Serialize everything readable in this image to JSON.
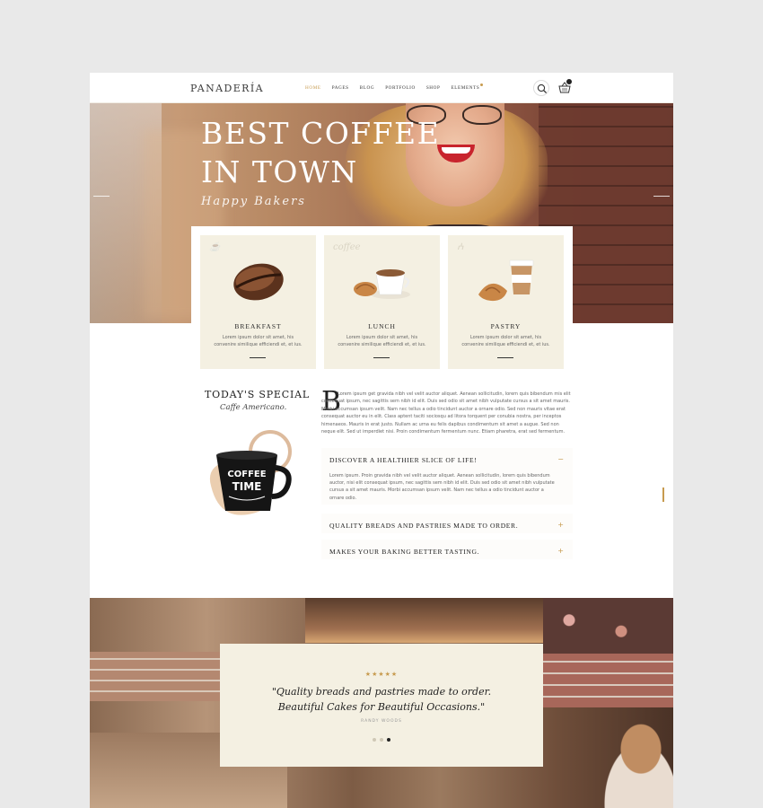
{
  "header": {
    "logo": "PANADERÍA",
    "nav": [
      "HOME",
      "PAGES",
      "BLOG",
      "PORTFOLIO",
      "SHOP",
      "ELEMENTS"
    ],
    "active_nav": "HOME",
    "cart_icon": "basket-icon",
    "search_icon": "search-icon"
  },
  "hero": {
    "title_line1": "BEST COFFEE",
    "title_line2": "IN TOWN",
    "script": "Happy Bakers"
  },
  "cards": [
    {
      "title": "BREAKFAST",
      "text": "Lorem ipsum dolor sit amet, his convenire similique efficiendi et, et ius.",
      "icon": "coffee-bean-icon"
    },
    {
      "title": "LUNCH",
      "text": "Lorem ipsum dolor sit amet, his convenire similique efficiendi et, et ius.",
      "icon": "coffee-cup-icon"
    },
    {
      "title": "PASTRY",
      "text": "Lorem ipsum dolor sit amet, his convenire similique efficiendi et, et ius.",
      "icon": "croissant-icon"
    }
  ],
  "special": {
    "title": "TODAY'S SPECIAL",
    "subtitle": "Caffe Americano.",
    "mug_text_1": "COFFEE",
    "mug_text_2": "TIME",
    "dropcap": "B",
    "body": "Lorem ipsum get gravida nibh vel velit auctor aliquet. Aenean sollicitudin, lorem quis bibendum mis elit consequat ipsum, nec sagittis sem nibh id elit. Duis sed odio sit amet nibh vulputate cursus a sit amet mauris. Morbi accumsan ipsum velit. Nam nec tellus a odio tincidunt auctor a ornare odio. Sed non mauris vitae erat consequat auctor eu in elit. Class aptent taciti sociosqu ad litora torquent per conubia nostra, per inceptos himenaeos. Mauris in erat justo. Nullam ac urna eu felis dapibus condimentum sit amet a augue. Sed non neque elit. Sed ut imperdiet nisi. Proin condimentum fermentum nunc. Etiam pharetra, erat sed fermentum."
  },
  "accordion": [
    {
      "heading": "DISCOVER A HEALTHIER SLICE OF LIFE!",
      "sign": "−",
      "body": "Lorem ipsum. Proin gravida nibh vel velit auctor aliquet. Aenean sollicitudin, lorem quis bibendum auctor, nisi elit consequat ipsum, nec sagittis sem nibh id elit. Duis sed odio sit amet nibh vulputate cursus a sit amet mauris. Morbi accumsan ipsum velit. Nam nec tellus a odio tincidunt auctor a ornare odio."
    },
    {
      "heading": "QUALITY BREADS AND PASTRIES MADE TO ORDER.",
      "sign": "+",
      "body": ""
    },
    {
      "heading": "MAKES YOUR BAKING BETTER TASTING.",
      "sign": "+",
      "body": ""
    }
  ],
  "testimonial": {
    "stars": "★★★★★",
    "quote_line1": "\"Quality breads and pastries made to order.",
    "quote_line2": "Beautiful Cakes for Beautiful Occasions.\"",
    "author": "RANDY WOODS",
    "slides": 3,
    "active_slide": 3
  },
  "colors": {
    "accent": "#c79b4f",
    "card_bg": "#f4f0e2"
  }
}
